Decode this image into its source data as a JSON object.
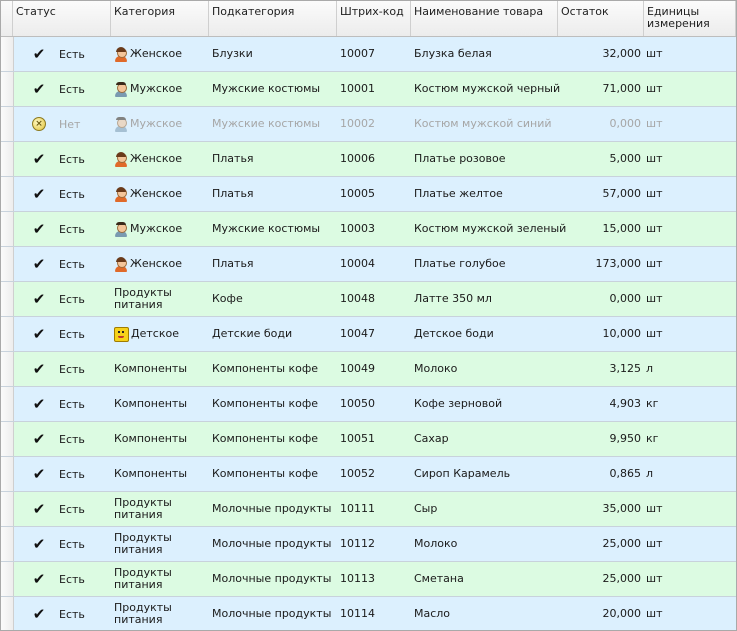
{
  "columns": {
    "status": "Статус",
    "category": "Категория",
    "subcategory": "Подкатегория",
    "barcode": "Штрих-код",
    "name": "Наименование товара",
    "stock": "Остаток",
    "unit": "Единицы измерения"
  },
  "colors": {
    "row_blue": "#dcf0fe",
    "row_green": "#dcfbe2"
  },
  "rows": [
    {
      "status": "Есть",
      "status_icon": "check-icon",
      "category": "Женское",
      "category_icon": "woman-icon",
      "subcategory": "Блузки",
      "barcode": "10007",
      "name": "Блузка белая",
      "stock": "32,000",
      "unit": "шт"
    },
    {
      "status": "Есть",
      "status_icon": "check-icon",
      "category": "Мужское",
      "category_icon": "man-icon",
      "subcategory": "Мужские костюмы",
      "barcode": "10001",
      "name": "Костюм мужской черный",
      "stock": "71,000",
      "unit": "шт"
    },
    {
      "status": "Нет",
      "status_icon": "cross-circle-icon",
      "category": "Мужское",
      "category_icon": "man-icon",
      "subcategory": "Мужские костюмы",
      "barcode": "10002",
      "name": "Костюм мужской синий",
      "stock": "0,000",
      "unit": "шт"
    },
    {
      "status": "Есть",
      "status_icon": "check-icon",
      "category": "Женское",
      "category_icon": "woman-icon",
      "subcategory": "Платья",
      "barcode": "10006",
      "name": "Платье розовое",
      "stock": "5,000",
      "unit": "шт"
    },
    {
      "status": "Есть",
      "status_icon": "check-icon",
      "category": "Женское",
      "category_icon": "woman-icon",
      "subcategory": "Платья",
      "barcode": "10005",
      "name": "Платье желтое",
      "stock": "57,000",
      "unit": "шт"
    },
    {
      "status": "Есть",
      "status_icon": "check-icon",
      "category": "Мужское",
      "category_icon": "man-icon",
      "subcategory": "Мужские костюмы",
      "barcode": "10003",
      "name": "Костюм мужской зеленый",
      "stock": "15,000",
      "unit": "шт"
    },
    {
      "status": "Есть",
      "status_icon": "check-icon",
      "category": "Женское",
      "category_icon": "woman-icon",
      "subcategory": "Платья",
      "barcode": "10004",
      "name": "Платье голубое",
      "stock": "173,000",
      "unit": "шт"
    },
    {
      "status": "Есть",
      "status_icon": "check-icon",
      "category": "Продукты питания",
      "category_icon": "",
      "subcategory": "Кофе",
      "barcode": "10048",
      "name": "Латте 350 мл",
      "stock": "0,000",
      "unit": "шт"
    },
    {
      "status": "Есть",
      "status_icon": "check-icon",
      "category": "Детское",
      "category_icon": "child-icon",
      "subcategory": "Детские боди",
      "barcode": "10047",
      "name": "Детское боди",
      "stock": "10,000",
      "unit": "шт"
    },
    {
      "status": "Есть",
      "status_icon": "check-icon",
      "category": "Компоненты",
      "category_icon": "",
      "subcategory": "Компоненты кофе",
      "barcode": "10049",
      "name": "Молоко",
      "stock": "3,125",
      "unit": "л"
    },
    {
      "status": "Есть",
      "status_icon": "check-icon",
      "category": "Компоненты",
      "category_icon": "",
      "subcategory": "Компоненты кофе",
      "barcode": "10050",
      "name": "Кофе зерновой",
      "stock": "4,903",
      "unit": "кг"
    },
    {
      "status": "Есть",
      "status_icon": "check-icon",
      "category": "Компоненты",
      "category_icon": "",
      "subcategory": "Компоненты кофе",
      "barcode": "10051",
      "name": "Сахар",
      "stock": "9,950",
      "unit": "кг"
    },
    {
      "status": "Есть",
      "status_icon": "check-icon",
      "category": "Компоненты",
      "category_icon": "",
      "subcategory": "Компоненты кофе",
      "barcode": "10052",
      "name": "Сироп Карамель",
      "stock": "0,865",
      "unit": "л"
    },
    {
      "status": "Есть",
      "status_icon": "check-icon",
      "category": "Продукты питания",
      "category_icon": "",
      "subcategory": "Молочные продукты",
      "barcode": "10111",
      "name": "Сыр",
      "stock": "35,000",
      "unit": "шт"
    },
    {
      "status": "Есть",
      "status_icon": "check-icon",
      "category": "Продукты питания",
      "category_icon": "",
      "subcategory": "Молочные продукты",
      "barcode": "10112",
      "name": "Молоко",
      "stock": "25,000",
      "unit": "шт"
    },
    {
      "status": "Есть",
      "status_icon": "check-icon",
      "category": "Продукты питания",
      "category_icon": "",
      "subcategory": "Молочные продукты",
      "barcode": "10113",
      "name": "Сметана",
      "stock": "25,000",
      "unit": "шт"
    },
    {
      "status": "Есть",
      "status_icon": "check-icon",
      "category": "Продукты питания",
      "category_icon": "",
      "subcategory": "Молочные продукты",
      "barcode": "10114",
      "name": "Масло",
      "stock": "20,000",
      "unit": "шт"
    }
  ]
}
